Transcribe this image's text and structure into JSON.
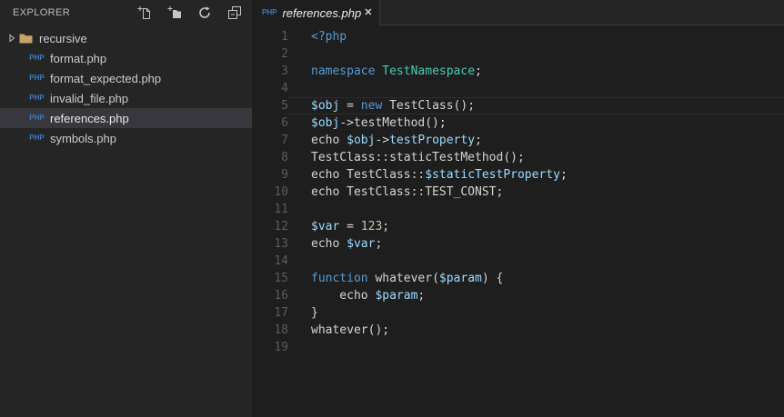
{
  "colors": {
    "sidebar_bg": "#252526",
    "editor_bg": "#1E1E1E",
    "selected_row_bg": "#37373D",
    "php_icon_blue": "#3E79C6",
    "folder_icon_tan": "#C8A269",
    "ui_icon_gray": "#C5C5C5",
    "syntax": {
      "kw": "#569CD6",
      "cls": "#4EC9B0",
      "var": "#9CDCFE",
      "num": "#B5CEA8",
      "def": "#D4D4D4"
    }
  },
  "sidebar": {
    "title": "EXPLORER",
    "toolbar": [
      {
        "name": "new-file",
        "label": "New File"
      },
      {
        "name": "new-folder",
        "label": "New Folder"
      },
      {
        "name": "refresh",
        "label": "Refresh"
      },
      {
        "name": "collapse-all",
        "label": "Collapse All"
      }
    ],
    "file_icon_text": "PHP",
    "items": [
      {
        "label": "recursive",
        "kind": "folder",
        "collapsed": true
      },
      {
        "label": "format.php",
        "kind": "php-file"
      },
      {
        "label": "format_expected.php",
        "kind": "php-file"
      },
      {
        "label": "invalid_file.php",
        "kind": "php-file"
      },
      {
        "label": "references.php",
        "kind": "php-file",
        "selected": true
      },
      {
        "label": "symbols.php",
        "kind": "php-file"
      }
    ]
  },
  "editor": {
    "tab": {
      "label": "references.php",
      "icon_text": "PHP",
      "close_glyph": "✕",
      "preview": true
    },
    "current_line": 5,
    "lines": [
      {
        "n": 1,
        "tokens": [
          {
            "t": "<?php",
            "c": "kw"
          }
        ]
      },
      {
        "n": 2,
        "tokens": []
      },
      {
        "n": 3,
        "tokens": [
          {
            "t": "namespace",
            "c": "kw"
          },
          {
            "t": " ",
            "c": "def"
          },
          {
            "t": "TestNamespace",
            "c": "cls"
          },
          {
            "t": ";",
            "c": "def"
          }
        ]
      },
      {
        "n": 4,
        "tokens": []
      },
      {
        "n": 5,
        "tokens": [
          {
            "t": "$obj",
            "c": "var"
          },
          {
            "t": " = ",
            "c": "def"
          },
          {
            "t": "new",
            "c": "kw"
          },
          {
            "t": " TestClass();",
            "c": "def"
          }
        ]
      },
      {
        "n": 6,
        "tokens": [
          {
            "t": "$obj",
            "c": "var"
          },
          {
            "t": "->testMethod();",
            "c": "def"
          }
        ]
      },
      {
        "n": 7,
        "tokens": [
          {
            "t": "echo ",
            "c": "def"
          },
          {
            "t": "$obj",
            "c": "var"
          },
          {
            "t": "->",
            "c": "def"
          },
          {
            "t": "testProperty",
            "c": "var"
          },
          {
            "t": ";",
            "c": "def"
          }
        ]
      },
      {
        "n": 8,
        "tokens": [
          {
            "t": "TestClass::staticTestMethod();",
            "c": "def"
          }
        ]
      },
      {
        "n": 9,
        "tokens": [
          {
            "t": "echo TestClass::",
            "c": "def"
          },
          {
            "t": "$staticTestProperty",
            "c": "var"
          },
          {
            "t": ";",
            "c": "def"
          }
        ]
      },
      {
        "n": 10,
        "tokens": [
          {
            "t": "echo TestClass::TEST_CONST;",
            "c": "def"
          }
        ]
      },
      {
        "n": 11,
        "tokens": []
      },
      {
        "n": 12,
        "tokens": [
          {
            "t": "$var",
            "c": "var"
          },
          {
            "t": " = ",
            "c": "def"
          },
          {
            "t": "123",
            "c": "num"
          },
          {
            "t": ";",
            "c": "def"
          }
        ]
      },
      {
        "n": 13,
        "tokens": [
          {
            "t": "echo ",
            "c": "def"
          },
          {
            "t": "$var",
            "c": "var"
          },
          {
            "t": ";",
            "c": "def"
          }
        ]
      },
      {
        "n": 14,
        "tokens": []
      },
      {
        "n": 15,
        "tokens": [
          {
            "t": "function",
            "c": "kw"
          },
          {
            "t": " whatever(",
            "c": "def"
          },
          {
            "t": "$param",
            "c": "var"
          },
          {
            "t": ") {",
            "c": "def"
          }
        ]
      },
      {
        "n": 16,
        "tokens": [
          {
            "t": "    echo ",
            "c": "def"
          },
          {
            "t": "$param",
            "c": "var"
          },
          {
            "t": ";",
            "c": "def"
          }
        ]
      },
      {
        "n": 17,
        "tokens": [
          {
            "t": "}",
            "c": "def"
          }
        ]
      },
      {
        "n": 18,
        "tokens": [
          {
            "t": "whatever();",
            "c": "def"
          }
        ]
      },
      {
        "n": 19,
        "tokens": []
      }
    ]
  }
}
